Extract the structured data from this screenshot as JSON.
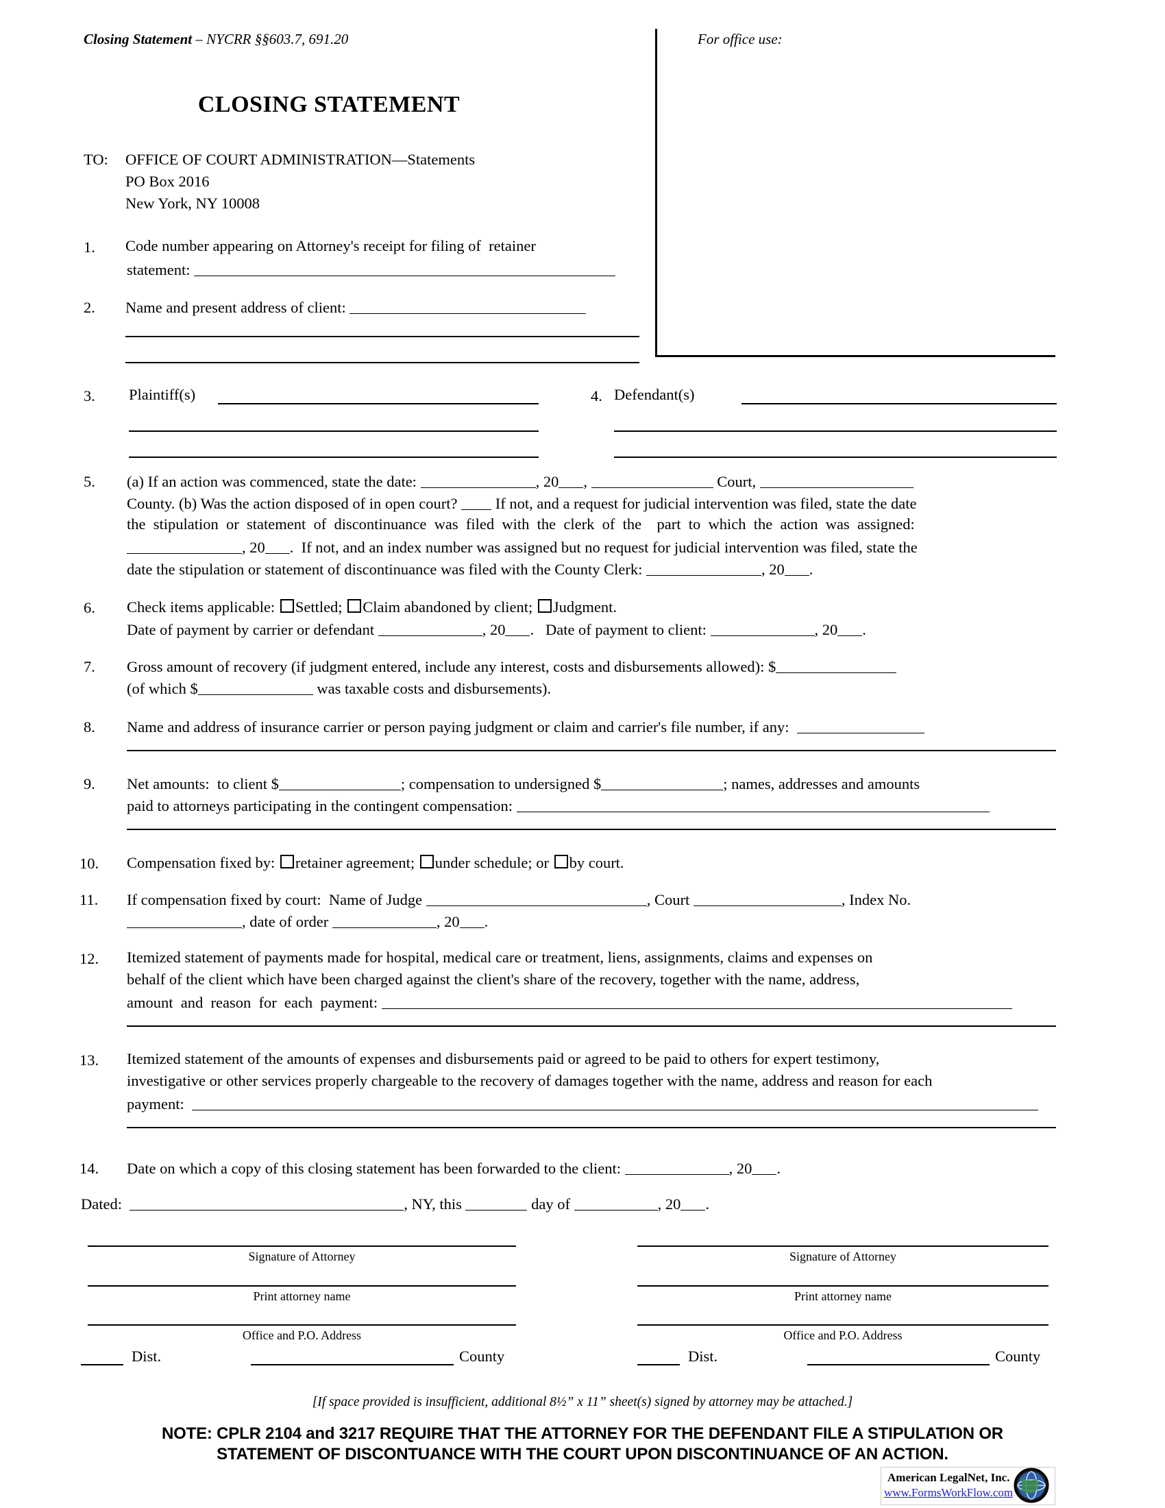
{
  "header": {
    "left_title_bold": "Closing Statement",
    "left_title_rest": " – NYCRR §§603.7, 691.20",
    "office_use": "For office use:"
  },
  "title": "CLOSING STATEMENT",
  "addressee": {
    "to_label": "TO:",
    "line1": "OFFICE OF COURT ADMINISTRATION—Statements",
    "line2": "PO Box 2016",
    "line3": "New York, NY 10008"
  },
  "items": {
    "n1": "1.",
    "i1_line1": "Code number appearing on Attorney's receipt for filing of  retainer",
    "i1_line2_pre": "statement: ",
    "n2": "2.",
    "i2_line1_pre": "Name and present address of client: ",
    "n3": "3.",
    "i3_label": "Plaintiff(s)",
    "n4": "4.",
    "i4_label": "Defendant(s)",
    "n5": "5.",
    "i5_a_pre": "(a) If an action was commenced, state the date: ",
    "i5_a_mid1": ", 20",
    "i5_a_mid2": ", ",
    "i5_a_court": " Court, ",
    "i5_b_line1": "County. (b) Was the action disposed of in open court? ",
    "i5_b_line1b": " If not, and a request for judicial intervention was filed, state the date",
    "i5_b_line2": "the  stipulation  or  statement  of  discontinuance  was  filed  with  the  clerk  of  the    part  to  which  the  action  was  assigned:",
    "i5_b_line3a": ", 20",
    "i5_b_line3b": ".  If not, and an index number was assigned but no request for judicial intervention was filed, state the",
    "i5_b_line4a": "date the stipulation or statement of discontinuance was filed with the County Clerk: ",
    "i5_b_line4b": ", 20",
    "i5_b_line4c": ".",
    "n6": "6.",
    "i6_line1_a": "Check items applicable: ",
    "i6_cb1": "Settled; ",
    "i6_cb2": "Claim abandoned by client; ",
    "i6_cb3": "Judgment.",
    "i6_line2_a": "Date of payment by carrier or defendant ",
    "i6_line2_b": ", 20",
    "i6_line2_c": ".   Date of payment to client: ",
    "i6_line2_d": ", 20",
    "i6_line2_e": ".",
    "n7": "7.",
    "i7_line1": "Gross amount of recovery (if judgment entered, include any interest, costs and disbursements allowed): $",
    "i7_line2_a": "(of which $",
    "i7_line2_b": " was taxable costs and disbursements).",
    "n8": "8.",
    "i8_line1": "Name and address of insurance carrier or person paying judgment or claim and carrier's file number, if any:  ",
    "n9": "9.",
    "i9_line1_a": "Net amounts:  to client $",
    "i9_line1_b": "; compensation to undersigned $",
    "i9_line1_c": "; names, addresses and amounts",
    "i9_line2_a": "paid to attorneys participating in the contingent compensation: ",
    "n10": "10.",
    "i10_a": "Compensation fixed by: ",
    "i10_cb1": "retainer agreement; ",
    "i10_cb2": "under schedule; or ",
    "i10_cb3": "by court.",
    "n11": "11.",
    "i11_line1_a": "If compensation fixed by court:  Name of Judge ",
    "i11_line1_b": ", Court ",
    "i11_line1_c": ", Index No.",
    "i11_line2_a": ", date of order ",
    "i11_line2_b": ", 20",
    "i11_line2_c": ".",
    "n12": "12.",
    "i12_line1": "Itemized statement of payments made for hospital, medical care or treatment, liens, assignments, claims and expenses on",
    "i12_line2": "behalf of the client which have been charged against the client's share of the recovery, together with the name, address,",
    "i12_line3": "amount  and  reason  for  each  payment: ",
    "n13": "13.",
    "i13_line1": "Itemized statement of the amounts of expenses and disbursements paid or agreed to be paid to others for expert testimony,",
    "i13_line2": "investigative or other services properly chargeable to the recovery of damages together with the name, address and reason for each",
    "i13_line3": "payment:  ",
    "n14": "14.",
    "i14_line1_a": "Date on which a copy of this closing statement has been forwarded to the client: ",
    "i14_line1_b": ", 20",
    "i14_line1_c": "."
  },
  "dated": {
    "label": "Dated:  ",
    "ny": ", NY, this ",
    "day_of": " day of ",
    "year": ", 20",
    "period": "."
  },
  "signatures": {
    "left": {
      "cap1": "Signature of Attorney",
      "cap2": "Print attorney name",
      "cap3": "Office and P.O. Address",
      "dist": "Dist.",
      "county": "County"
    },
    "right": {
      "cap1": "Signature of Attorney",
      "cap2": "Print attorney name",
      "cap3": "Office and P.O. Address",
      "dist": "Dist.",
      "county": "County"
    }
  },
  "footer": {
    "italic_note": "[If space provided is insufficient, additional 8½” x 11” sheet(s) signed by attorney may be attached.]",
    "note_line1": "NOTE: CPLR 2104 and 3217 REQUIRE THAT THE ATTORNEY FOR THE DEFENDANT FILE A STIPULATION OR",
    "note_line2": "STATEMENT OF DISCONTUANCE WITH THE COURT UPON DISCONTINUANCE OF AN ACTION."
  },
  "logo": {
    "company": "American LegalNet, Inc.",
    "url": "www.FormsWorkFlow.com",
    "icon": "globe-icon"
  },
  "colors": {
    "ink": "#000000",
    "link": "#2222cc",
    "paper": "#ffffff"
  }
}
